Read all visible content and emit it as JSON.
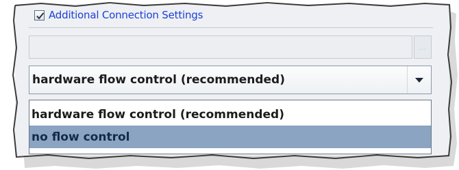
{
  "settings": {
    "checkbox_label": "Additional Connection Settings",
    "checked": true
  },
  "disabled_field": {
    "value": "",
    "button_label": "..."
  },
  "flow_control": {
    "selected": "hardware flow control (recommended)",
    "options": [
      "hardware flow control (recommended)",
      "no flow control"
    ],
    "highlighted_option": "no flow control"
  },
  "colors": {
    "link_blue": "#1b3fd8",
    "highlight": "#8aa4c2",
    "panel_bg": "#eef0f3"
  },
  "icons": {
    "checkbox": "check-icon",
    "combo_arrow": "chevron-down-icon"
  }
}
